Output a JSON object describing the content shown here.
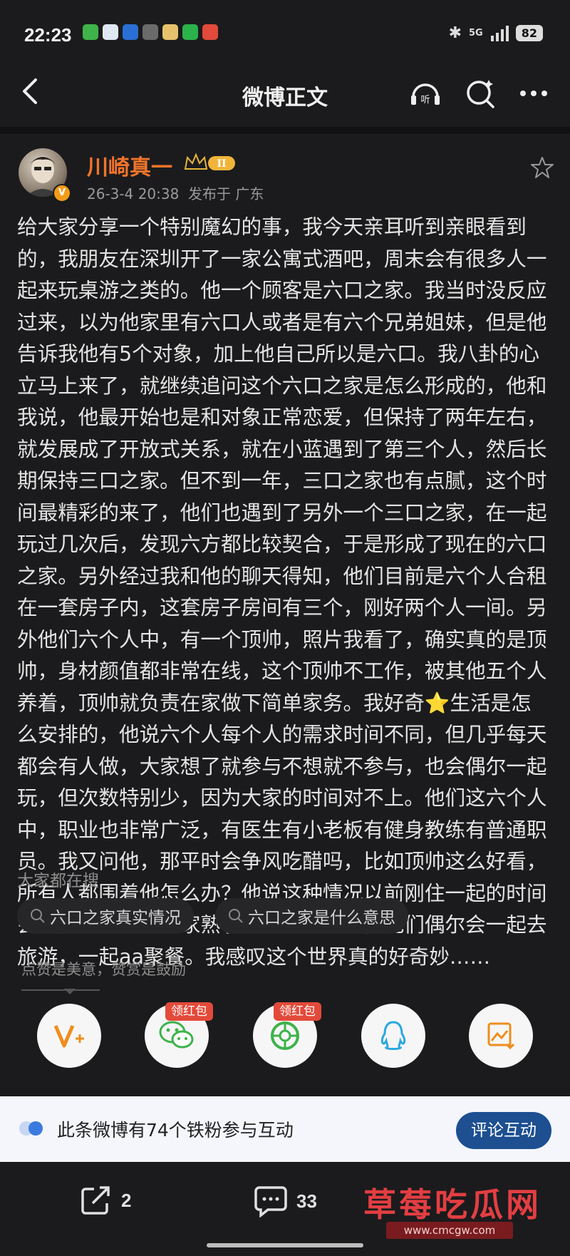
{
  "status_bar": {
    "time": "22:23",
    "network": "5G",
    "battery": "82"
  },
  "nav": {
    "title": "微博正文"
  },
  "author": {
    "name": "川崎真一",
    "level": "II",
    "time": "26-3-4 20:38",
    "location": "发布于 广东"
  },
  "post": {
    "lines": [
      "给大家分享一个特别魔幻的事，我今天亲耳听到亲眼看到",
      "的，我朋友在深圳开了一家公寓式酒吧，周末会有很多人一",
      "起来玩桌游之类的。他一个顾客是六口之家。我当时没反应",
      "过来，以为他家里有六口人或者是有六个兄弟姐妹，但是他",
      "告诉我他有5个对象，加上他自己所以是六口。我八卦的心",
      "立马上来了，就继续追问这个六口之家是怎么形成的，他和",
      "我说，他最开始也是和对象正常恋爱，但保持了两年左右，",
      "就发展成了开放式关系，就在小蓝遇到了第三个人，然后长",
      "期保持三口之家。但不到一年，三口之家也有点腻，这个时",
      "间最精彩的来了，他们也遇到了另外一个三口之家，在一起",
      "玩过几次后，发现六方都比较契合，于是形成了现在的六口",
      "之家。另外经过我和他的聊天得知，他们目前是六个人合租",
      "在一套房子内，这套房子房间有三个，刚好两个人一间。另",
      "外他们六个人中，有一个顶帅，照片我看了，确实真的是顶",
      "帅，身材颜值都非常在线，这个顶帅不工作，被其他五个人",
      "养着，顶帅就负责在家做下简单家务。我好奇⭐生活是怎",
      "么安排的，他说六个人每个人的需求时间不同，但几乎每天",
      "都会有人做，大家想了就参与不想就不参与，也会偶尔一起",
      "玩，但次数特别少，因为大家的时间对不上。他们这六个人",
      "中，职业也非常广泛，有医生有小老板有健身教练有普通职",
      "员。我又问他，那平时会争风吃醋吗，比如顶帅这么好看，",
      "所有人都围着他怎么办？他说这种情况以前刚住一起的时间",
      "会有，但是现在大家熟了就不会这样了，他们偶尔会一起去",
      "旅游，一起aa聚餐。我感叹这个世界真的好奇妙……"
    ]
  },
  "search": {
    "title": "大家都在搜",
    "chips": [
      "六口之家真实情况",
      "六口之家是什么意思"
    ]
  },
  "like_hint": "点赞是美意，赞赏是鼓励",
  "share": {
    "red_packet_label": "领红包"
  },
  "iron_fans": {
    "text": "此条微博有74个铁粉参与互动",
    "button": "评论互动"
  },
  "bottom_bar": {
    "repost_count": "2",
    "comment_count": "33"
  },
  "watermark": {
    "title": "草莓吃瓜网",
    "url": "www.cmcgw.com"
  },
  "colors": {
    "accent": "#f0742b",
    "brand_blue": "#1d4f91",
    "red": "#e34a3a"
  }
}
